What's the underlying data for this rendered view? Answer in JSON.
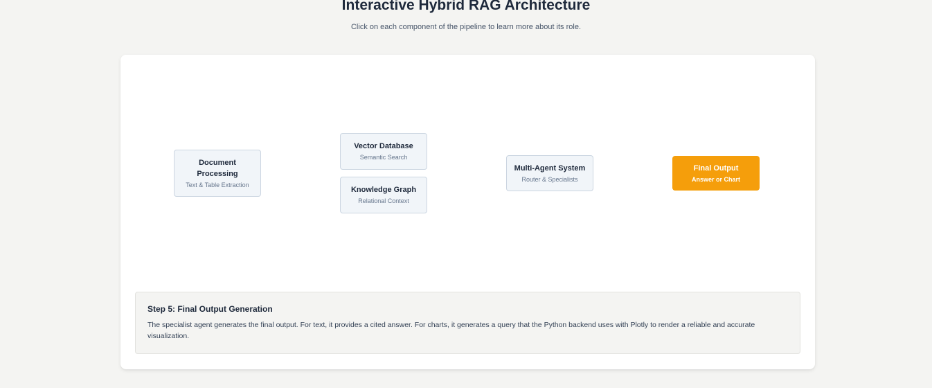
{
  "header": {
    "title": "Interactive Hybrid RAG Architecture",
    "subtitle": "Click on each component of the pipeline to learn more about its role."
  },
  "pipeline": {
    "nodes": [
      {
        "title": "Document Processing",
        "subtitle": "Text & Table Extraction",
        "active": false
      },
      {
        "title": "Vector Database",
        "subtitle": "Semantic Search",
        "active": false
      },
      {
        "title": "Knowledge Graph",
        "subtitle": "Relational Context",
        "active": false
      },
      {
        "title": "Multi-Agent System",
        "subtitle": "Router & Specialists",
        "active": false
      },
      {
        "title": "Final Output",
        "subtitle": "Answer or Chart",
        "active": true
      }
    ]
  },
  "details": {
    "title": "Step 5: Final Output Generation",
    "text": "The specialist agent generates the final output. For text, it provides a cited answer. For charts, it generates a query that the Python backend uses with Plotly to render a reliable and accurate visualization."
  },
  "colors": {
    "active_node": "#f59e0b",
    "node_bg": "#f1f5f9",
    "node_border": "#cbd5e1"
  }
}
